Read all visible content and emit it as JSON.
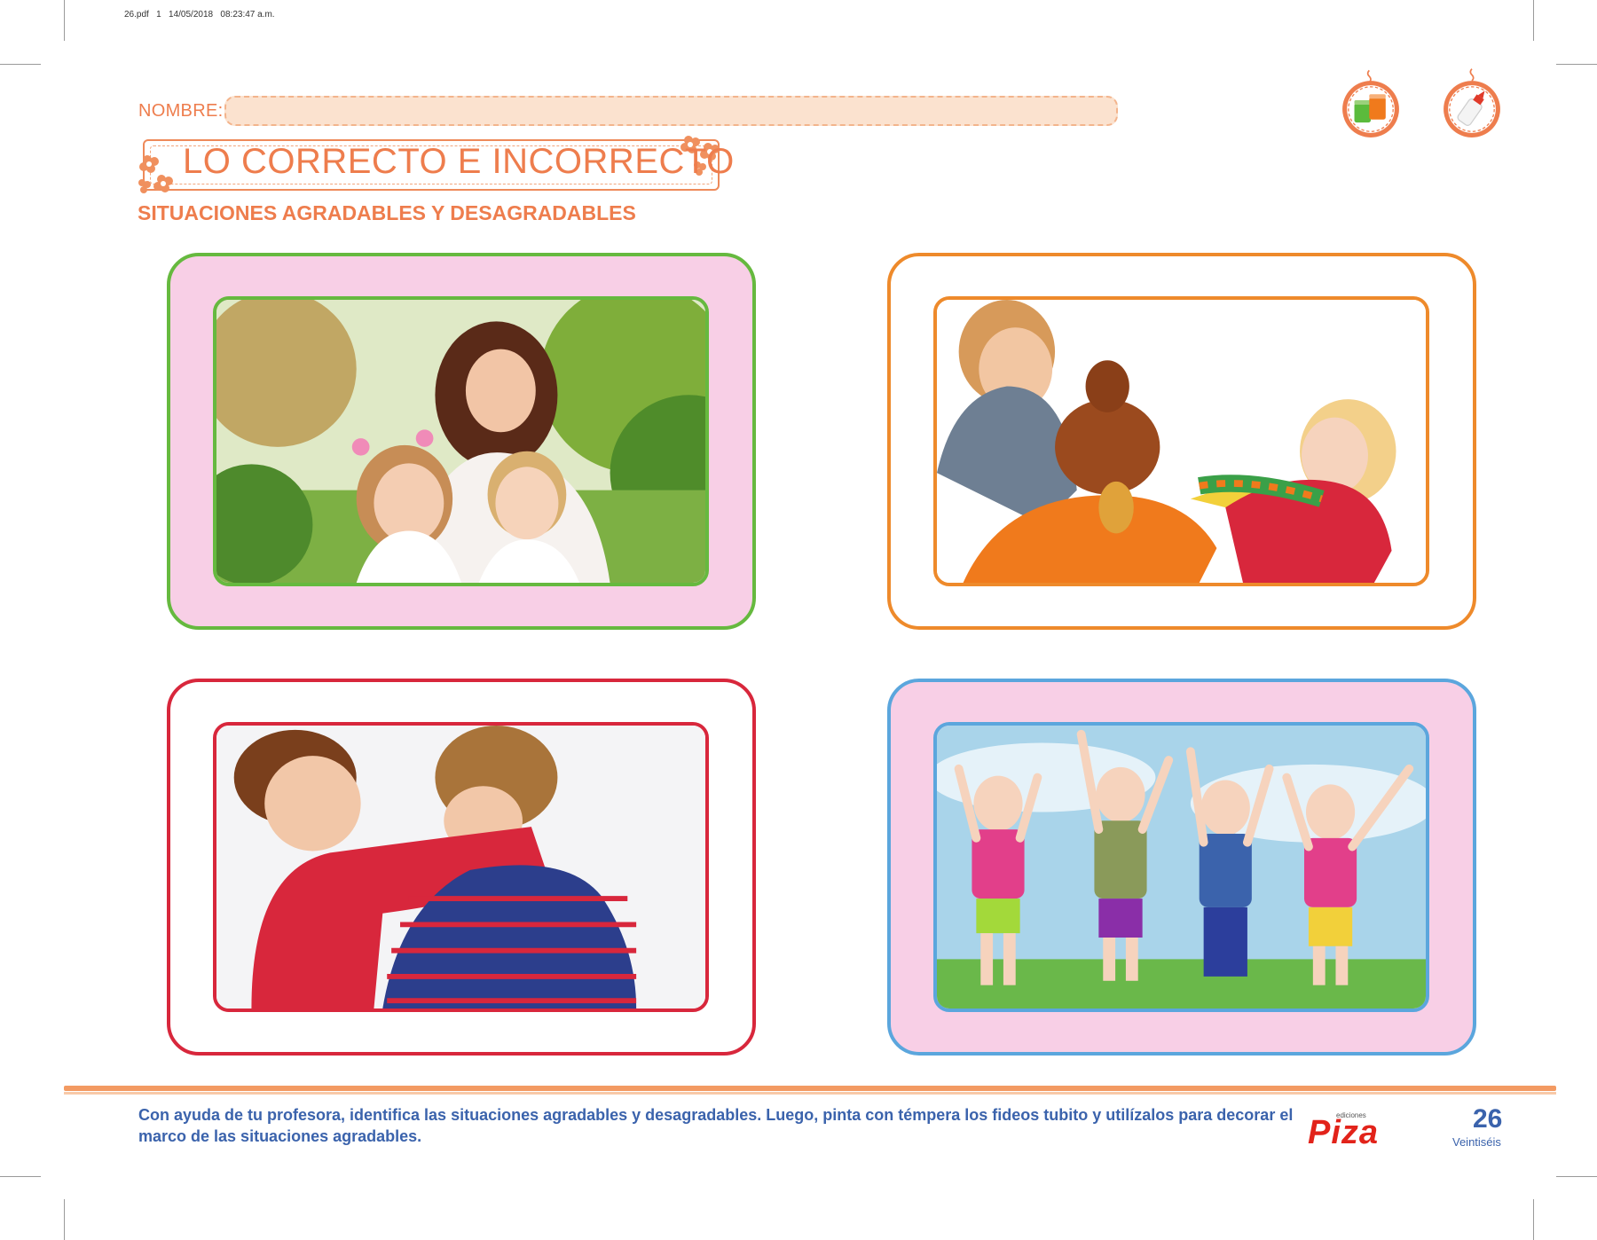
{
  "print_info": "26.pdf   1   14/05/2018   08:23:47 a.m.",
  "header": {
    "name_label": "NOMBRE:",
    "title": "LO CORRECTO E INCORRECTO",
    "subtitle": "SITUACIONES AGRADABLES Y DESAGRADABLES"
  },
  "badges": [
    {
      "icon": "tempera-paint-jars-icon"
    },
    {
      "icon": "glue-bottle-icon"
    }
  ],
  "frames": [
    {
      "picture": "mother-with-two-children-photo",
      "outer_color": "#66b93f",
      "inner_color": "#66b93f",
      "fill": "#f8cfe6"
    },
    {
      "picture": "children-fighting-over-teddy-photo",
      "outer_color": "#ee8a2b",
      "inner_color": "#ee8a2b",
      "fill": "#ffffff"
    },
    {
      "picture": "two-boys-fighting-photo",
      "outer_color": "#d8273c",
      "inner_color": "#d8273c",
      "fill": "#ffffff"
    },
    {
      "picture": "happy-children-jumping-photo",
      "outer_color": "#5ba6dd",
      "inner_color": "#5ba6dd",
      "fill": "#f8cfe6"
    }
  ],
  "footer": {
    "instructions": "Con ayuda de tu profesora, identifica las situaciones agradables y desagradables. Luego, pinta con témpera los fideos tubito y utilízalos para decorar el marco de las situaciones agradables.",
    "logo_small": "ediciones",
    "logo_main": "Piza",
    "page_number": "26",
    "page_word": "Veintiséis"
  },
  "colors": {
    "accent_orange": "#ee7d4d",
    "text_blue": "#3b63ac",
    "logo_red": "#e2231a"
  }
}
